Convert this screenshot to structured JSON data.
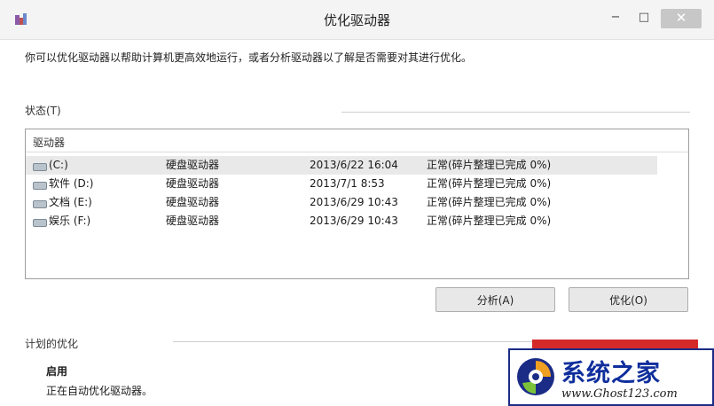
{
  "window": {
    "title": "优化驱动器",
    "minimize": "−",
    "maximize": "□",
    "close": "✕"
  },
  "description": "你可以优化驱动器以帮助计算机更高效地运行，或者分析驱动器以了解是否需要对其进行优化。",
  "status": {
    "label": "状态(T)",
    "header": "驱动器",
    "drives": [
      {
        "name": "(C:)",
        "type": "硬盘驱动器",
        "last_run": "2013/6/22 16:04",
        "status": "正常(碎片整理已完成 0%)"
      },
      {
        "name": "软件 (D:)",
        "type": "硬盘驱动器",
        "last_run": "2013/7/1 8:53",
        "status": "正常(碎片整理已完成 0%)"
      },
      {
        "name": "文档 (E:)",
        "type": "硬盘驱动器",
        "last_run": "2013/6/29 10:43",
        "status": "正常(碎片整理已完成 0%)"
      },
      {
        "name": "娱乐 (F:)",
        "type": "硬盘驱动器",
        "last_run": "2013/6/29 10:43",
        "status": "正常(碎片整理已完成 0%)"
      }
    ]
  },
  "buttons": {
    "analyze": "分析(A)",
    "optimize": "优化(O)"
  },
  "scheduled": {
    "label": "计划的优化",
    "state": "启用",
    "description": "正在自动优化驱动器。"
  },
  "watermark": {
    "title": "系统之家",
    "url": "www.Ghost123.com"
  },
  "colors": {
    "accent_red": "#d42a2a",
    "watermark_blue": "#0f2e9c"
  }
}
